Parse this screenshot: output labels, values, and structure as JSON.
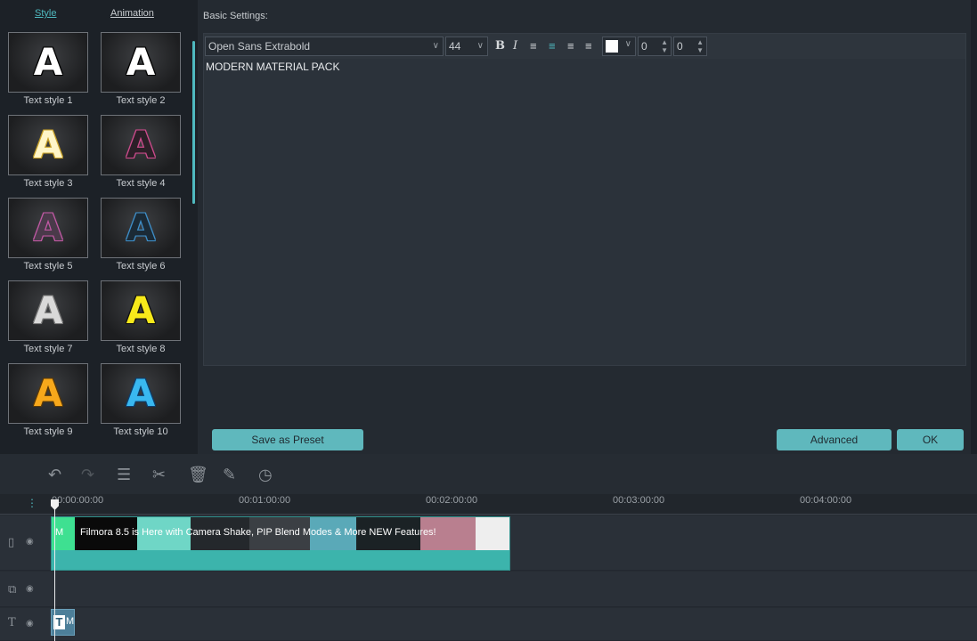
{
  "tabs": {
    "style": "Style",
    "animation": "Animation"
  },
  "text_styles": [
    {
      "label": "Text style 1",
      "glyph": "A",
      "color": "#ffffff",
      "outline": "#000000"
    },
    {
      "label": "Text style 2",
      "glyph": "A",
      "color": "#ffffff",
      "outline": "#000000"
    },
    {
      "label": "Text style 3",
      "glyph": "A",
      "color": "#fff6c8",
      "outline": "#caa32a"
    },
    {
      "label": "Text style 4",
      "glyph": "A",
      "color": "#2b1f27",
      "outline": "#d04c8e"
    },
    {
      "label": "Text style 5",
      "glyph": "A",
      "color": "#4a3a4a",
      "outline": "#c25aa5"
    },
    {
      "label": "Text style 6",
      "glyph": "A",
      "color": "#1b2a36",
      "outline": "#3f8fc9"
    },
    {
      "label": "Text style 7",
      "glyph": "A",
      "color": "#d9d9d9",
      "outline": "#7a7a7a"
    },
    {
      "label": "Text style 8",
      "glyph": "A",
      "color": "#f7e91a",
      "outline": "#111111"
    },
    {
      "label": "Text style 9",
      "glyph": "A",
      "color": "#f7a81b",
      "outline": "#5a3a0a"
    },
    {
      "label": "Text style 10",
      "glyph": "A",
      "color": "#39b8f0",
      "outline": "#0d3f6e"
    }
  ],
  "settings": {
    "label": "Basic Settings:",
    "font": "Open Sans Extrabold",
    "size": "44",
    "bold": "B",
    "italic": "I",
    "spin1": "0",
    "spin2": "0",
    "text_color": "#ffffff",
    "text": "MODERN MATERIAL PACK"
  },
  "buttons": {
    "save_preset": "Save as Preset",
    "advanced": "Advanced",
    "ok": "OK"
  },
  "timeline": {
    "timecodes": [
      "00:00:00:00",
      "00:01:00:00",
      "00:02:00:00",
      "00:03:00:00",
      "00:04:00:00"
    ],
    "clip_title": "Filmora 8.5 is Here with Camera Shake, PIP Blend Modes & More NEW Features!",
    "clip_prefix": "M",
    "text_clip_icon": "T",
    "text_clip_label": "M"
  },
  "accent_color": "#5fb8bd"
}
